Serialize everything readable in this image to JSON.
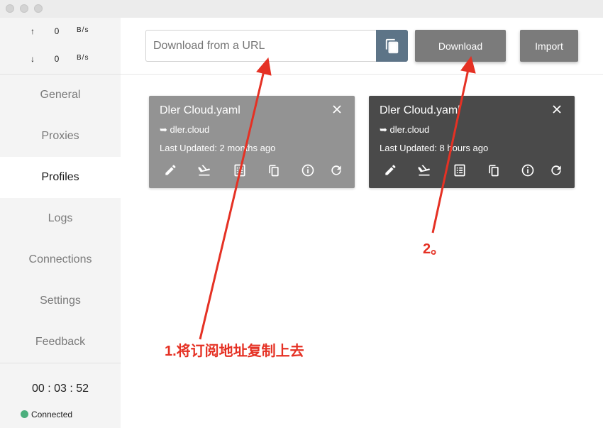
{
  "speed": {
    "upload_arrow": "↑",
    "upload_value": "0",
    "upload_unit": "B/s",
    "download_arrow": "↓",
    "download_value": "0",
    "download_unit": "B/s"
  },
  "nav": {
    "items": [
      {
        "label": "General"
      },
      {
        "label": "Proxies"
      },
      {
        "label": "Profiles",
        "active": true
      },
      {
        "label": "Logs"
      },
      {
        "label": "Connections"
      },
      {
        "label": "Settings"
      },
      {
        "label": "Feedback"
      }
    ]
  },
  "footer": {
    "timer": "00 : 03 : 52",
    "status": "Connected",
    "status_color": "#4caf7d"
  },
  "toolbar": {
    "url_placeholder": "Download from a URL",
    "url_value": "",
    "download_label": "Download",
    "import_label": "Import"
  },
  "profiles": [
    {
      "title": "Dler Cloud.yaml",
      "source_arrow": "➥",
      "source": "dler.cloud",
      "updated": "Last Updated: 2 months ago",
      "background": "#939393",
      "icons": [
        "edit-icon",
        "download-icon",
        "list-icon",
        "copy-icon",
        "info-icon",
        "refresh-icon"
      ]
    },
    {
      "title": "Dler Cloud.yaml",
      "source_arrow": "➥",
      "source": "dler.cloud",
      "updated": "Last Updated: 8 hours ago",
      "background": "#4a4a4a",
      "icons": [
        "edit-icon",
        "download-icon",
        "list-icon",
        "copy-icon",
        "info-icon",
        "refresh-icon"
      ]
    }
  ],
  "annotations": {
    "step1": "1.将订阅地址复制上去",
    "step2": "2。",
    "color": "#e53124"
  }
}
